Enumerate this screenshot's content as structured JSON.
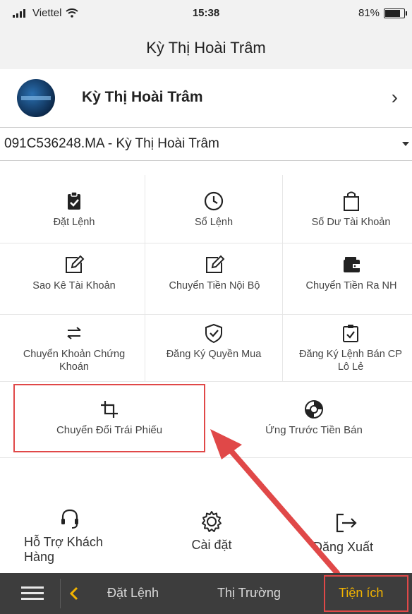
{
  "status": {
    "carrier": "Viettel",
    "time": "15:38",
    "battery": "81%"
  },
  "header": {
    "title": "Kỳ Thị Hoài Trâm"
  },
  "profile": {
    "name": "Kỳ Thị Hoài Trâm"
  },
  "account": {
    "selected": "091C536248.MA - Kỳ Thị Hoài Trâm"
  },
  "menu": {
    "items": [
      {
        "label": "Đặt Lệnh",
        "icon": "clipboard-check-icon"
      },
      {
        "label": "Sổ Lệnh",
        "icon": "clock-icon"
      },
      {
        "label": "Số Dư Tài Khoản",
        "icon": "shopping-bag-icon"
      },
      {
        "label": "Sao Kê Tài Khoản",
        "icon": "edit-icon"
      },
      {
        "label": "Chuyển Tiền Nội Bộ",
        "icon": "edit-icon"
      },
      {
        "label": "Chuyển Tiền Ra NH",
        "icon": "wallet-icon"
      },
      {
        "label": "Chuyển Khoản Chứng Khoán",
        "icon": "transfer-arrows-icon"
      },
      {
        "label": "Đăng Ký Quyền Mua",
        "icon": "shield-check-icon"
      },
      {
        "label": "Đăng Ký Lệnh Bán CP Lô Lẻ",
        "icon": "calendar-check-icon"
      },
      {
        "label": "Chuyển Đổi Trái Phiếu",
        "icon": "crop-icon"
      },
      {
        "label": "Ứng Trước Tiền Bán",
        "icon": "life-ring-icon"
      }
    ]
  },
  "extras": {
    "support": "Hỗ Trợ Khách Hàng",
    "settings": "Cài đặt",
    "logout": "Đăng Xuất"
  },
  "tabbar": {
    "items": [
      "Đặt Lệnh",
      "Thị Trường",
      "Tiện ích"
    ]
  },
  "colors": {
    "highlight": "#e04848",
    "arrow": "#e04848",
    "active_tab": "#f3b400",
    "tab_bar_bg": "#3d3d3d"
  }
}
